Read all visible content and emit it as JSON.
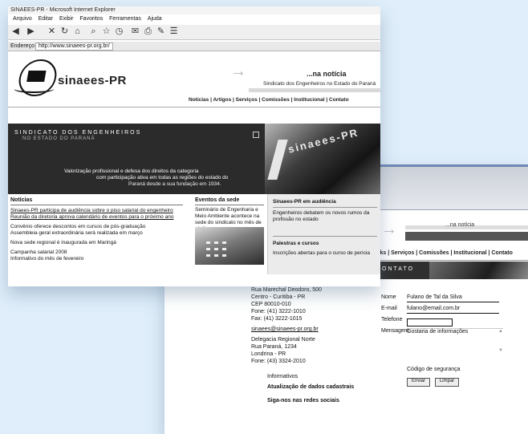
{
  "back_page": {
    "brand_text": "...na notícia",
    "nav": "Links | Serviços | Comissões | Institucional | Contato",
    "banner_text": "CONTATO",
    "left_text": [
      "Rua Marechal Deodoro, 500",
      "Centro - Curitiba - PR",
      "CEP 80010-010",
      "Fone: (41) 3222-1010",
      "Fax: (41) 3222-1015",
      "sinaees@sinaees-pr.org.br",
      "Delegacia Regional Norte",
      "Rua Paraná, 1234",
      "Londrina - PR",
      "Fone: (43) 3324-2010",
      "Informativos",
      "Atualização de dados cadastrais",
      "Siga-nos nas redes sociais"
    ],
    "form": {
      "name_label": "Nome",
      "name_value": "Fulano de Tal da Silva",
      "email_label": "E-mail",
      "email_value": "fulano@email.com.br",
      "phone_label": "Telefone",
      "message_label": "Mensagem",
      "message_value": "Gostaria de informações",
      "captcha_label": "Código de segurança",
      "send_label": "Enviar",
      "clear_label": "Limpar"
    }
  },
  "front_page": {
    "window_title": "SINAEES-PR - Microsoft Internet Explorer",
    "menu": [
      "Arquivo",
      "Editar",
      "Exibir",
      "Favoritos",
      "Ferramentas",
      "Ajuda"
    ],
    "toolbar_icons": [
      "back-icon",
      "forward-icon",
      "stop-icon",
      "refresh-icon",
      "home-icon",
      "search-icon",
      "favorites-icon",
      "history-icon",
      "mail-icon",
      "print-icon",
      "edit-icon",
      "discuss-icon"
    ],
    "toolbar_glyphs": [
      "◀",
      "▶",
      "✕",
      "↻",
      "⌂",
      "⌕",
      "☆",
      "◷",
      "✉",
      "⎙",
      "✎",
      "☰"
    ],
    "address_label": "Endereço",
    "address_value": "http://www.sinaees-pr.org.br/",
    "brand": "sinaees-PR",
    "tagline_title": "...na notícia",
    "tagline_sub": "Sindicato dos Engenheiros no Estado do Paraná",
    "nav": "Notícias | Artigos | Serviços | Comissões | Institucional | Contato",
    "banner_title": "SINDICATO DOS ENGENHEIROS",
    "banner_sub": "NO ESTADO DO PARANÁ",
    "banner_line1": "Valorização profissional e defesa dos direitos da categoria",
    "banner_line2": "com participação ativa em todas as regiões do estado do",
    "banner_line3": "Paraná desde a sua fundação em 1934.",
    "photo_sign": "sinaees-PR",
    "news_heading": "Notícias",
    "news": [
      "Sinaees-PR participa de audiência sobre o piso salarial do engenheiro",
      "Reunião da diretoria aprova calendário de eventos para o próximo ano",
      "Convênio oferece descontos em cursos de pós-graduação",
      "Assembleia geral extraordinária será realizada em março",
      "Nova sede regional é inaugurada em Maringá",
      "Campanha salarial 2008",
      "Informativo do mês de fevereiro"
    ],
    "events_heading": "Eventos da sede",
    "events_text": "Seminário de Engenharia e Meio Ambiente acontece na sede do sindicato no mês de abril",
    "side_items": [
      "Sinaees-PR em audiência",
      "Engenheiros debatem os novos rumos da profissão no estado",
      "Palestras e cursos",
      "Inscrições abertas para o curso de perícia"
    ]
  },
  "colors": {
    "background": "#dfeefa",
    "banner": "#2b2b2b",
    "nav_text": "#222222"
  }
}
